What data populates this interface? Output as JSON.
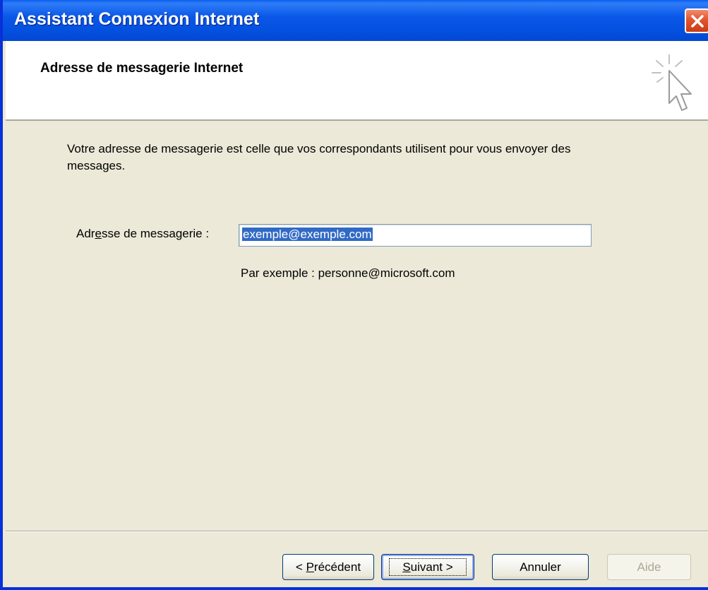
{
  "window": {
    "title": "Assistant Connexion Internet",
    "close_icon": "close-icon"
  },
  "header": {
    "title": "Adresse de messagerie Internet",
    "icon": "wizard-cursor-icon"
  },
  "content": {
    "description": "Votre adresse de messagerie est celle que vos correspondants utilisent pour vous envoyer des messages.",
    "email_label_pre": "Adr",
    "email_label_mnemonic": "e",
    "email_label_post": "sse de messagerie :",
    "email_value": "exemple@exemple.com",
    "example": "Par exemple : personne@microsoft.com"
  },
  "buttons": {
    "back_pre": "< ",
    "back_mnemonic": "P",
    "back_post": "récédent",
    "next_mnemonic": "S",
    "next_post": "uivant >",
    "cancel": "Annuler",
    "help": "Aide"
  },
  "colors": {
    "titlebar": "#0a58e8",
    "selection": "#316ac5",
    "dialog_bg": "#ece9d8"
  }
}
